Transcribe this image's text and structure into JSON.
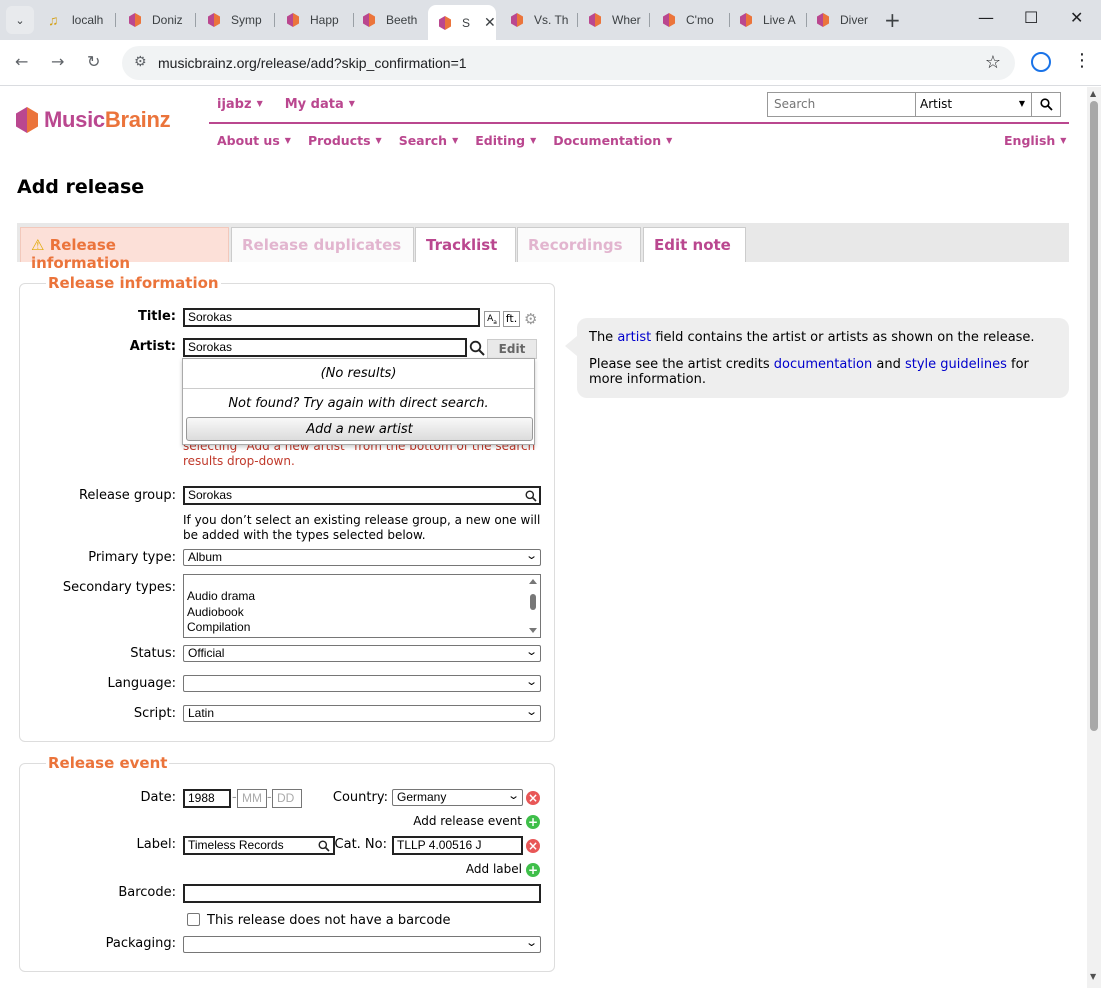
{
  "browser": {
    "tabs": [
      {
        "title": "localh",
        "favicon": "music-note-icon"
      },
      {
        "title": "Doniz",
        "favicon": "musicbrainz-icon"
      },
      {
        "title": "Symp",
        "favicon": "musicbrainz-icon"
      },
      {
        "title": "Happ",
        "favicon": "musicbrainz-icon"
      },
      {
        "title": "Beeth",
        "favicon": "musicbrainz-icon"
      },
      {
        "title": "S",
        "favicon": "musicbrainz-icon",
        "active": true
      },
      {
        "title": "Vs. Th",
        "favicon": "musicbrainz-icon"
      },
      {
        "title": "Wher",
        "favicon": "musicbrainz-icon"
      },
      {
        "title": "C'mo",
        "favicon": "musicbrainz-icon"
      },
      {
        "title": "Live A",
        "favicon": "musicbrainz-icon"
      },
      {
        "title": "Diver",
        "favicon": "musicbrainz-icon"
      }
    ],
    "url": "musicbrainz.org/release/add?skip_confirmation=1"
  },
  "header": {
    "logo_text_1": "Music",
    "logo_text_2": "Brainz",
    "user_menu": [
      "ijabz",
      "My data"
    ],
    "search_placeholder": "Search",
    "search_type": "Artist",
    "main_menu": [
      "About us",
      "Products",
      "Search",
      "Editing",
      "Documentation"
    ],
    "language": "English"
  },
  "page": {
    "title": "Add release",
    "tabs": [
      "Release information",
      "Release duplicates",
      "Tracklist",
      "Recordings",
      "Edit note"
    ]
  },
  "release_info": {
    "legend": "Release information",
    "title_label": "Title:",
    "title_value": "Sorokas",
    "artist_label": "Artist:",
    "artist_value": "Sorokas",
    "edit_button": "Edit",
    "dropdown": {
      "no_results": "(No results)",
      "not_found": "Not found? Try again with direct search.",
      "add_artist": "Add a new artist"
    },
    "error_line1": "selecting \"Add a new artist\" from the bottom of the search",
    "error_line2": "results drop-down.",
    "release_group_label": "Release group:",
    "release_group_value": "Sorokas",
    "release_group_note": "If you don’t select an existing release group, a new one will be added with the types selected below.",
    "primary_type_label": "Primary type:",
    "primary_type_value": "Album",
    "secondary_types_label": "Secondary types:",
    "secondary_types_options": [
      "Audio drama",
      "Audiobook",
      "Compilation"
    ],
    "status_label": "Status:",
    "status_value": "Official",
    "language_label": "Language:",
    "language_value": "",
    "script_label": "Script:",
    "script_value": "Latin"
  },
  "help": {
    "p1_pre": "The ",
    "p1_link": "artist",
    "p1_post": " field contains the artist or artists as shown on the release.",
    "p2_pre": "Please see the artist credits ",
    "p2_link1": "documentation",
    "p2_mid": " and ",
    "p2_link2": "style guidelines",
    "p2_post": " for more information."
  },
  "release_event": {
    "legend": "Release event",
    "date_label": "Date:",
    "year": "1988",
    "month_placeholder": "MM",
    "day_placeholder": "DD",
    "country_label": "Country:",
    "country_value": "Germany",
    "add_release_event": "Add release event",
    "label_label": "Label:",
    "label_value": "Timeless Records",
    "catno_label": "Cat. No:",
    "catno_value": "TLLP 4.00516 J",
    "add_label": "Add label",
    "barcode_label": "Barcode:",
    "barcode_value": "",
    "no_barcode": "This release does not have a barcode",
    "packaging_label": "Packaging:",
    "packaging_value": ""
  },
  "colors": {
    "brand_purple": "#ba478f",
    "brand_orange": "#eb743b",
    "link_blue": "#0000cc",
    "error_red": "#c0392b"
  }
}
